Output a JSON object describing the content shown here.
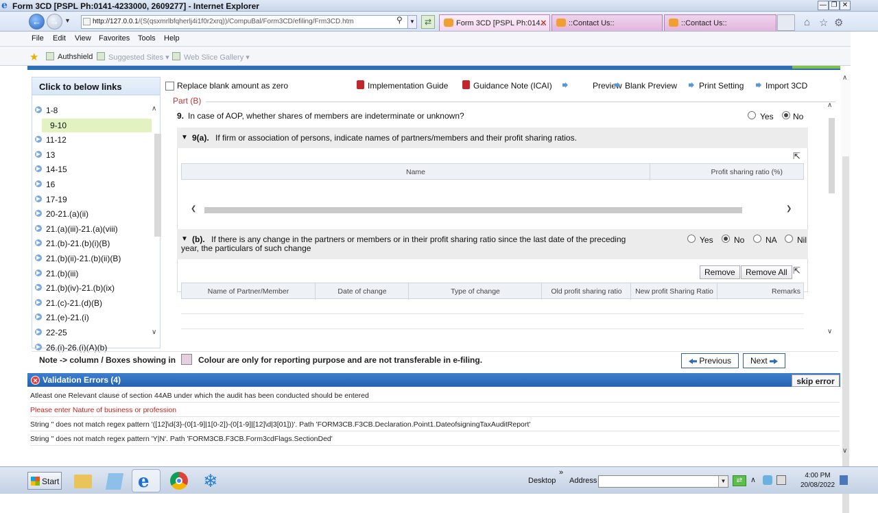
{
  "window": {
    "title": "Form 3CD [PSPL Ph:0141-4233000, 2609277] - Internet Explorer",
    "url_prefix": "http://127.0.0.1",
    "url_rest": "/(S(qsxmrlbfqherlj4i1f0r2xrq))/CompuBal/Form3CD/efiling/Frm3CD.htm"
  },
  "tabs": [
    {
      "label": "Form 3CD [PSPL Ph:014..."
    },
    {
      "label": "::Contact Us::"
    },
    {
      "label": "::Contact Us::"
    }
  ],
  "menu": [
    "File",
    "Edit",
    "View",
    "Favorites",
    "Tools",
    "Help"
  ],
  "favorites": [
    {
      "label": "Authshield"
    },
    {
      "label": "Suggested Sites ▾"
    },
    {
      "label": "Web Slice Gallery ▾"
    }
  ],
  "sidebar": {
    "title": "Click to below links",
    "items": [
      "1-8",
      "9-10",
      "11-12",
      "13",
      "14-15",
      "16",
      "17-19",
      "20-21.(a)(ii)",
      "21.(a)(iii)-21.(a)(viii)",
      "21.(b)-21.(b)(i)(B)",
      "21.(b)(ii)-21.(b)(ii)(B)",
      "21.(b)(iii)",
      "21.(b)(iv)-21.(b)(ix)",
      "21.(c)-21.(d)(B)",
      "21.(e)-21.(i)",
      "22-25",
      "26.(i)-26.(i)(A)(b)"
    ]
  },
  "toolbar": {
    "replace_blank": "Replace blank amount as zero",
    "implementation_guide": "Implementation Guide",
    "guidance_note": "Guidance Note (ICAI)",
    "preview": "Preview",
    "blank_preview": "Blank Preview",
    "print_setting": "Print Setting",
    "import_3cd": "Import 3CD"
  },
  "main": {
    "part_label": "Part (B)",
    "q9_num": "9.",
    "q9": "In case of AOP, whether shares of members are indeterminate or unknown?",
    "q9_yes": "Yes",
    "q9_no": "No",
    "q9a_num": "9(a).",
    "q9a": "If firm or association of persons, indicate names of partners/members and their profit sharing ratios.",
    "grid1_cols": [
      "Name",
      "Profit sharing ratio (%)"
    ],
    "qb_num": "(b).",
    "qb_line1": "If there is any change in the partners or members or in their profit sharing ratio since the last date of the preceding",
    "qb_line2": "year, the particulars of such change",
    "qb_opts": [
      "Yes",
      "No",
      "NA",
      "Nil"
    ],
    "remove": "Remove",
    "remove_all": "Remove All",
    "grid2_cols": [
      "Name of Partner/Member",
      "Date of change",
      "Type of change",
      "Old profit sharing ratio",
      "New profit Sharing Ratio",
      "Remarks"
    ]
  },
  "note": {
    "left": "Note -> column / Boxes showing in",
    "right": "Colour are only for reporting purpose and are not transferable in e-filing."
  },
  "pager": {
    "previous": "Previous",
    "next": "Next"
  },
  "validation": {
    "title": "Validation Errors (4)",
    "skip": "skip error",
    "errors": [
      "Atleast one Relevant clause of section 44AB under which the audit has been conducted should be entered",
      "Please enter Nature of business or profession",
      "String '' does not match regex pattern '([12]\\d{3}-(0[1-9]|1[0-2])-(0[1-9]|[12]\\d|3[01]))'. Path 'FORM3CB.F3CB.Declaration.Point1.DateofsigningTaxAuditReport'",
      "String '' does not match regex pattern 'Y|N'. Path 'FORM3CB.F3CB.Form3cdFlags.SectionDed'"
    ]
  },
  "taskbar": {
    "start": "Start",
    "desktop": "Desktop",
    "address": "Address",
    "chevron": "»",
    "time": "4:00 PM",
    "date": "20/08/2022"
  }
}
